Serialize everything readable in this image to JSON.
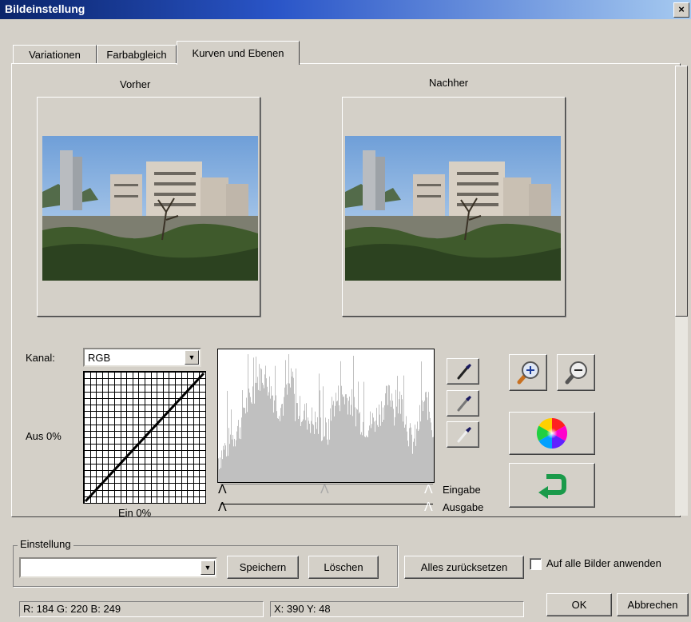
{
  "window": {
    "title": "Bildeinstellung",
    "close_label": "×"
  },
  "tabs": [
    {
      "label": "Variationen"
    },
    {
      "label": "Farbabgleich"
    },
    {
      "label": "Kurven und Ebenen"
    }
  ],
  "preview": {
    "before_label": "Vorher",
    "after_label": "Nachher"
  },
  "curves": {
    "channel_label": "Kanal:",
    "channel_value": "RGB",
    "output_label": "Aus 0%",
    "input_label": "Ein 0%",
    "input_slider_label": "Eingabe",
    "output_slider_label": "Ausgabe"
  },
  "tools": {
    "icons": [
      "eyedropper-black-icon",
      "eyedropper-gray-icon",
      "eyedropper-white-icon",
      "zoom-in-icon",
      "zoom-out-icon",
      "color-wheel-icon",
      "undo-arrow-icon"
    ]
  },
  "settings": {
    "group_label": "Einstellung",
    "preset_value": "",
    "save_label": "Speichern",
    "delete_label": "Löschen",
    "reset_all_label": "Alles zurücksetzen",
    "apply_all_label": "Auf alle Bilder anwenden",
    "apply_all_checked": false
  },
  "status": {
    "rgb_readout": "R: 184 G: 220 B: 249",
    "xy_readout": "X: 390   Y: 48"
  },
  "actions": {
    "ok_label": "OK",
    "cancel_label": "Abbrechen"
  },
  "colors": {
    "titlebar": "#0a246a",
    "dialog": "#d4d0c8",
    "histogram": "#c0c0c0",
    "undo_arrow": "#1a9a4a"
  }
}
